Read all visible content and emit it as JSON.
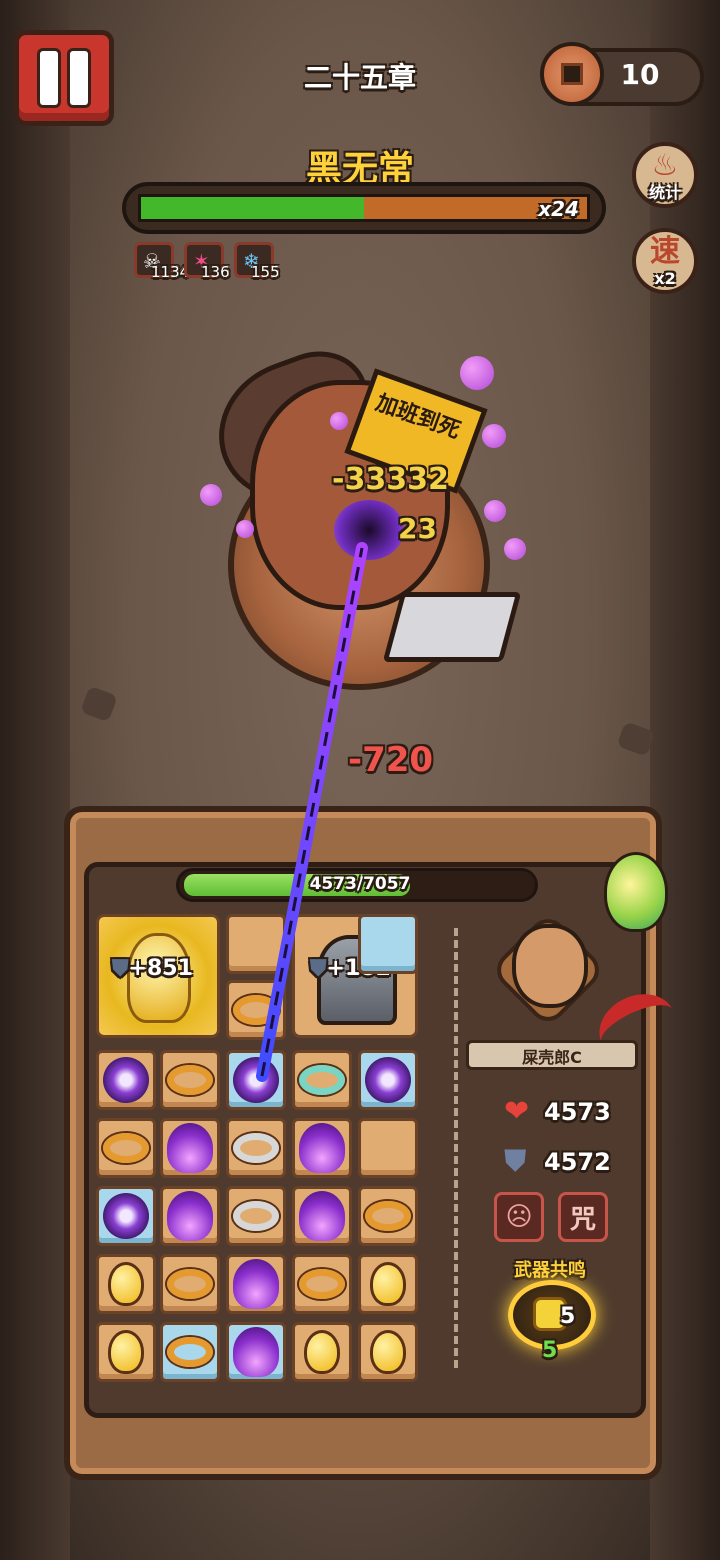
{
  "header": {
    "chapter": "二十五章",
    "coins": "10"
  },
  "boss": {
    "name": "黑无常",
    "hp_fraction": 0.5,
    "multiplier": "x24",
    "debuffs": [
      {
        "icon": "skull-icon",
        "value": "1134",
        "color": "#c98bf0"
      },
      {
        "icon": "slash-icon",
        "value": "136",
        "color": "#f04b8a"
      },
      {
        "icon": "snowflake-icon",
        "value": "155",
        "color": "#6cc3f3"
      }
    ],
    "damage_popups": [
      "-33332",
      "23"
    ],
    "damage_taken": "-720",
    "sign_text": "加班到死"
  },
  "side_buttons": {
    "stats_label": "统计",
    "speed_glyph": "速",
    "speed_label": "x2",
    "stats_glyph": "♨"
  },
  "player": {
    "hp_text": "4573/7057",
    "hp_fraction": 0.648,
    "hero_name": "屎壳郎C",
    "health": "4573",
    "armor": "4572",
    "resonance_label": "武器共鸣",
    "resonance_value": "5",
    "resonance_sub": "5"
  },
  "board": {
    "buddha_bonus": "+851",
    "bell_bonus": "+182",
    "accent": "#43b82a"
  }
}
